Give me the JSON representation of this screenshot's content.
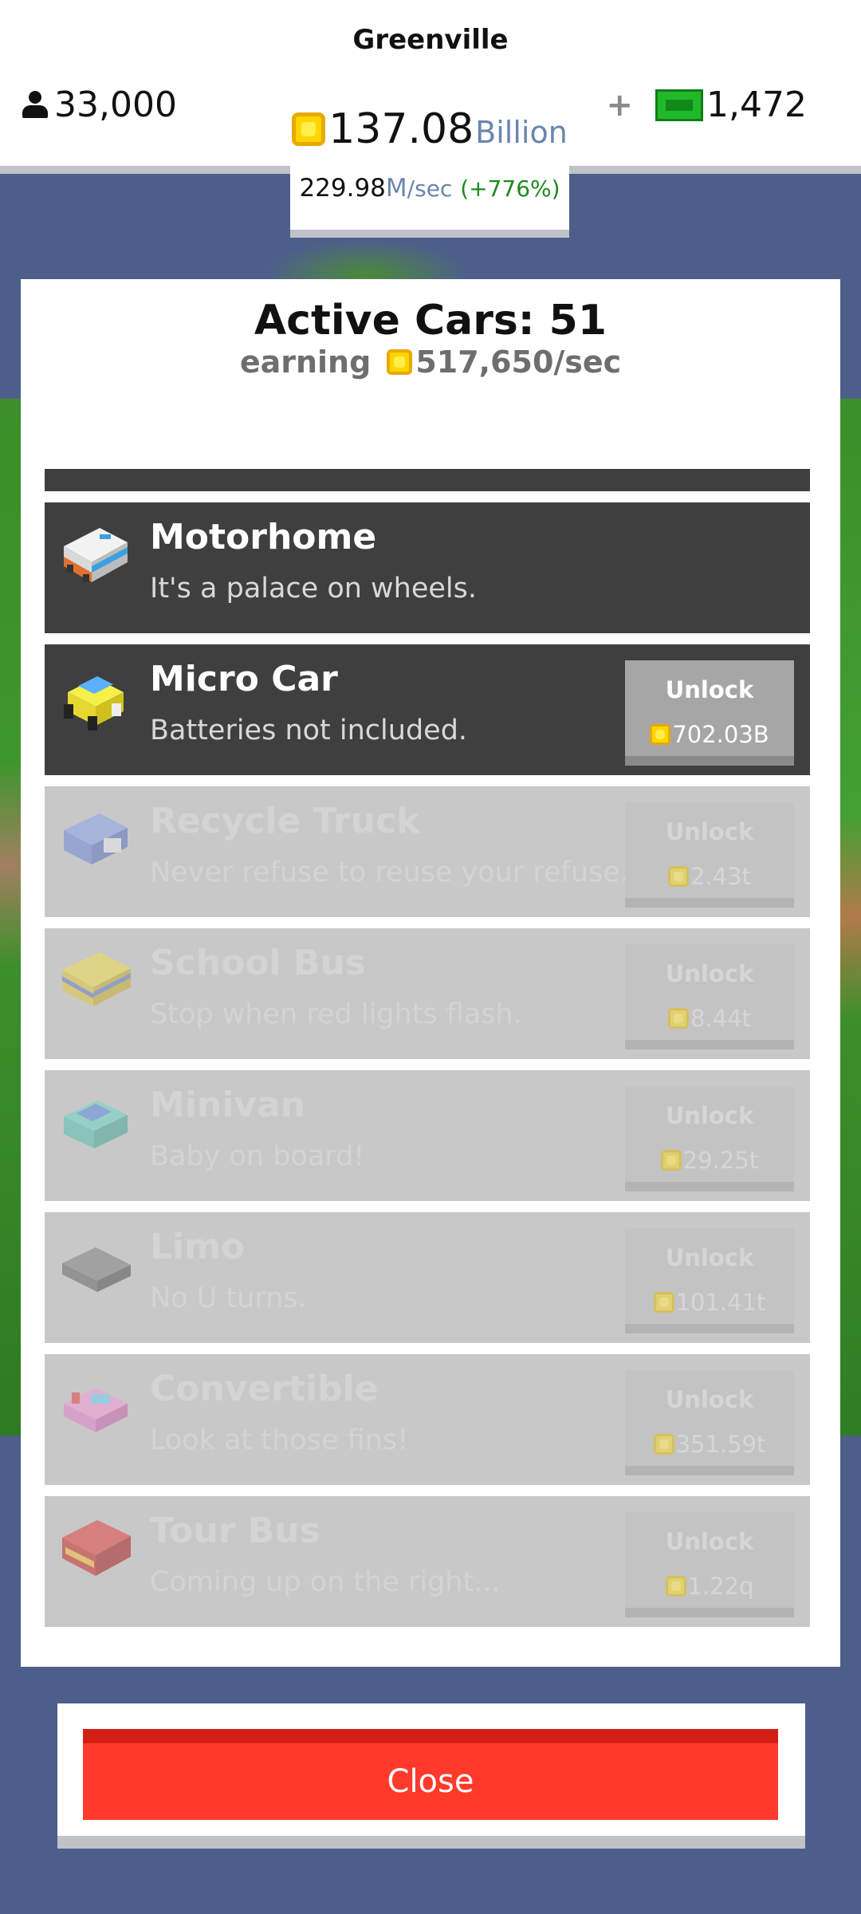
{
  "header": {
    "city_name": "Greenville",
    "population": "33,000",
    "plus": "+",
    "cash": "1,472",
    "money_amount": "137.08",
    "money_unit": "Billion",
    "rate_value": "229.98",
    "rate_unit": "M",
    "rate_suffix": "/sec",
    "rate_change": "(+776%)"
  },
  "panel": {
    "title": "Active Cars: 51",
    "earning_label": "earning",
    "earning_value": "517,650/sec"
  },
  "cars": [
    {
      "name": "Motorhome",
      "desc": "It's a palace on wheels.",
      "state": "unlocked",
      "icon": "motorhome-icon"
    },
    {
      "name": "Micro Car",
      "desc": "Batteries not included.",
      "state": "available",
      "unlock_label": "Unlock",
      "price": "702.03B",
      "icon": "micro-car-icon"
    },
    {
      "name": "Recycle Truck",
      "desc": "Never refuse to reuse your refuse.",
      "state": "locked",
      "unlock_label": "Unlock",
      "price": "2.43t",
      "icon": "recycle-truck-icon"
    },
    {
      "name": "School Bus",
      "desc": "Stop when red lights flash.",
      "state": "locked",
      "unlock_label": "Unlock",
      "price": "8.44t",
      "icon": "school-bus-icon"
    },
    {
      "name": "Minivan",
      "desc": "Baby on board!",
      "state": "locked",
      "unlock_label": "Unlock",
      "price": "29.25t",
      "icon": "minivan-icon"
    },
    {
      "name": "Limo",
      "desc": "No U turns.",
      "state": "locked",
      "unlock_label": "Unlock",
      "price": "101.41t",
      "icon": "limo-icon"
    },
    {
      "name": "Convertible",
      "desc": "Look at those fins!",
      "state": "locked",
      "unlock_label": "Unlock",
      "price": "351.59t",
      "icon": "convertible-icon"
    },
    {
      "name": "Tour Bus",
      "desc": "Coming up on the right...",
      "state": "locked",
      "unlock_label": "Unlock",
      "price": "1.22q",
      "icon": "tour-bus-icon"
    }
  ],
  "close_label": "Close",
  "colors": {
    "background": "#4d5e8b",
    "close_button": "#ff3a2b",
    "coin": "#ffd500",
    "cash": "#21b92a",
    "rate_change": "#1f8a1f"
  }
}
